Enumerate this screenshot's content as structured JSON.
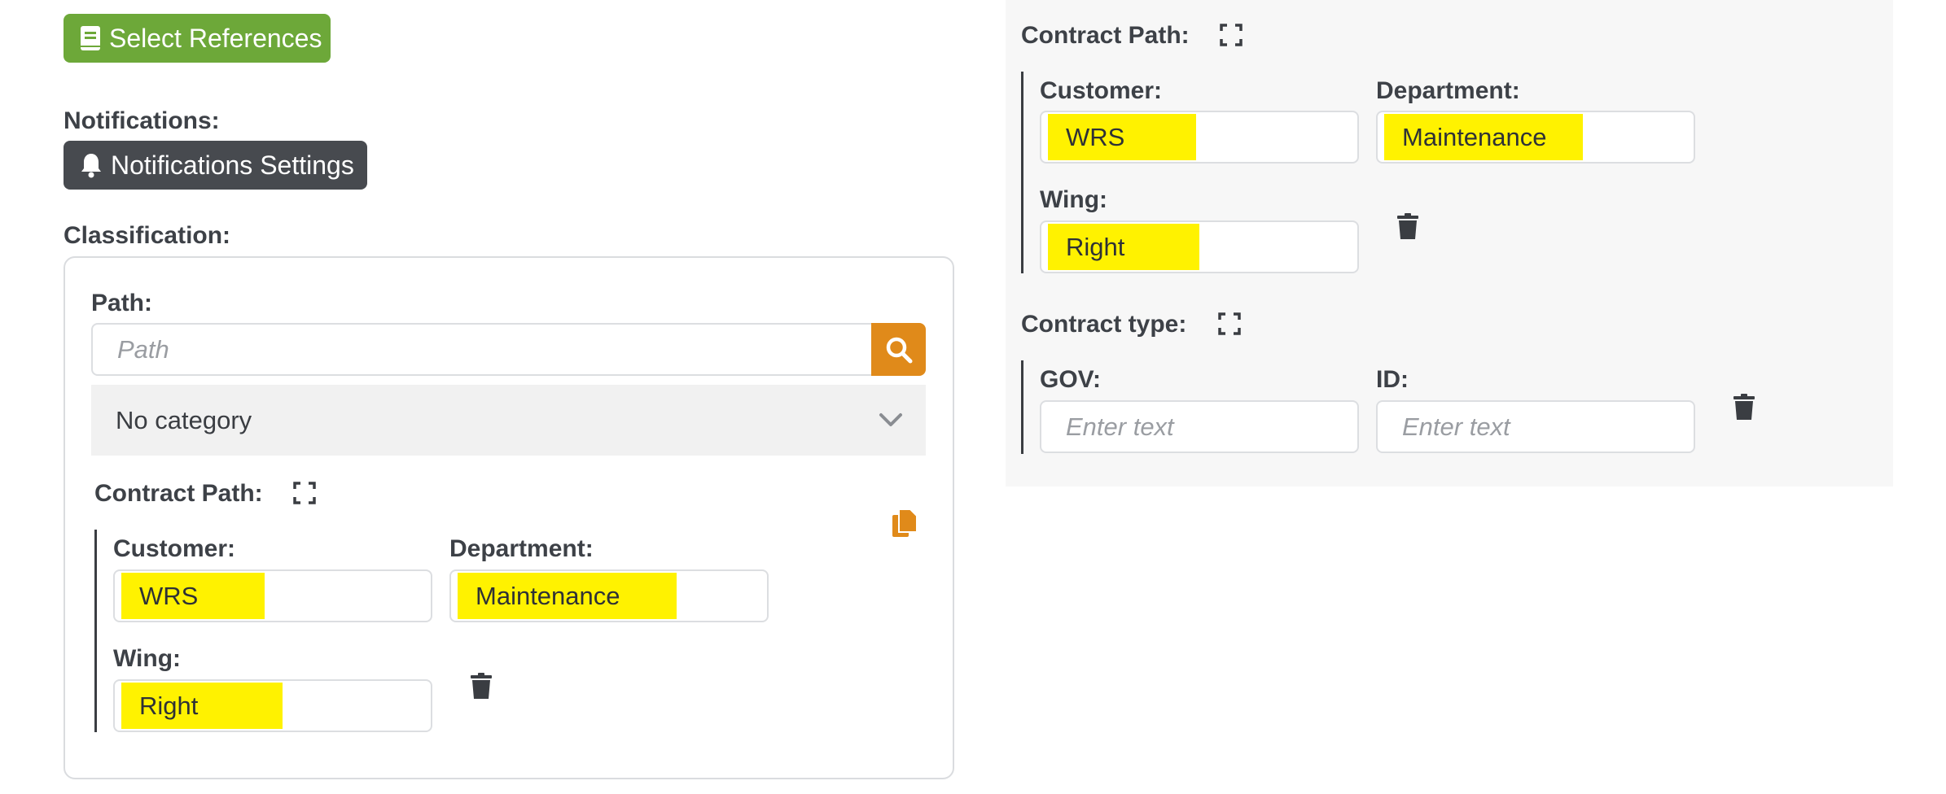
{
  "top": {
    "select_references_label": "Select References",
    "notifications_label": "Notifications:",
    "notifications_settings_label": "Notifications Settings",
    "classification_label": "Classification:"
  },
  "classification": {
    "path_label": "Path:",
    "path_placeholder": "Path",
    "category_selected": "No category",
    "contract_path_label": "Contract Path:",
    "customer_label": "Customer:",
    "customer_value": "WRS",
    "department_label": "Department:",
    "department_value": "Maintenance",
    "wing_label": "Wing:",
    "wing_value": "Right"
  },
  "right_panel": {
    "contract_path_label": "Contract Path:",
    "customer_label": "Customer:",
    "customer_value": "WRS",
    "department_label": "Department:",
    "department_value": "Maintenance",
    "wing_label": "Wing:",
    "wing_value": "Right",
    "contract_type_label": "Contract type:",
    "gov_label": "GOV:",
    "gov_placeholder": "Enter text",
    "id_label": "ID:",
    "id_placeholder": "Enter text"
  },
  "colors": {
    "green_button": "#6da839",
    "dark_button": "#474a4f",
    "search_orange": "#e08a1a",
    "highlight_yellow": "#fff200"
  },
  "icons": [
    "book-icon",
    "bell-icon",
    "search-icon",
    "chevron-down-icon",
    "expand-icon",
    "copy-icon",
    "trash-icon"
  ]
}
